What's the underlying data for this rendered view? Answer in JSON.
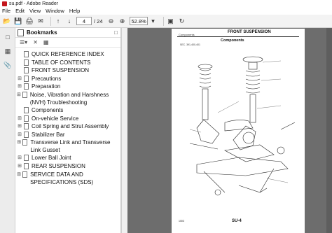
{
  "window": {
    "title": "su.pdf - Adobe Reader"
  },
  "menu": [
    "File",
    "Edit",
    "View",
    "Window",
    "Help"
  ],
  "toolbar": {
    "page_current": "4",
    "page_total": "/ 24",
    "zoom": "52.8%"
  },
  "panel": {
    "title": "Bookmarks"
  },
  "bookmarks": [
    {
      "label": "QUICK REFERENCE INDEX",
      "expandable": false
    },
    {
      "label": "TABLE OF CONTENTS",
      "expandable": false
    },
    {
      "label": "FRONT SUSPENSION",
      "expandable": false
    },
    {
      "label": "Precautions",
      "expandable": true
    },
    {
      "label": "Preparation",
      "expandable": true
    },
    {
      "label": "Noise, Vibration and Harshness (NVH) Troubleshooting",
      "expandable": true
    },
    {
      "label": "Components",
      "expandable": false
    },
    {
      "label": "On-vehicle Service",
      "expandable": true
    },
    {
      "label": "Coil Spring and Strut Assembly",
      "expandable": true
    },
    {
      "label": "Stabilizer Bar",
      "expandable": true
    },
    {
      "label": "Transverse Link and Transverse Link Gusset",
      "expandable": true
    },
    {
      "label": "Lower Ball Joint",
      "expandable": true
    },
    {
      "label": "REAR SUSPENSION",
      "expandable": true
    },
    {
      "label": "SERVICE DATA AND SPECIFICATIONS (SDS)",
      "expandable": true
    }
  ],
  "pdf_page": {
    "section_header": "FRONT SUSPENSION",
    "breadcrumb": "Components",
    "heading": "Components",
    "sec_ref": "SEC. 391-400-401",
    "page_label": "SU-4",
    "footer_left": "1003"
  }
}
